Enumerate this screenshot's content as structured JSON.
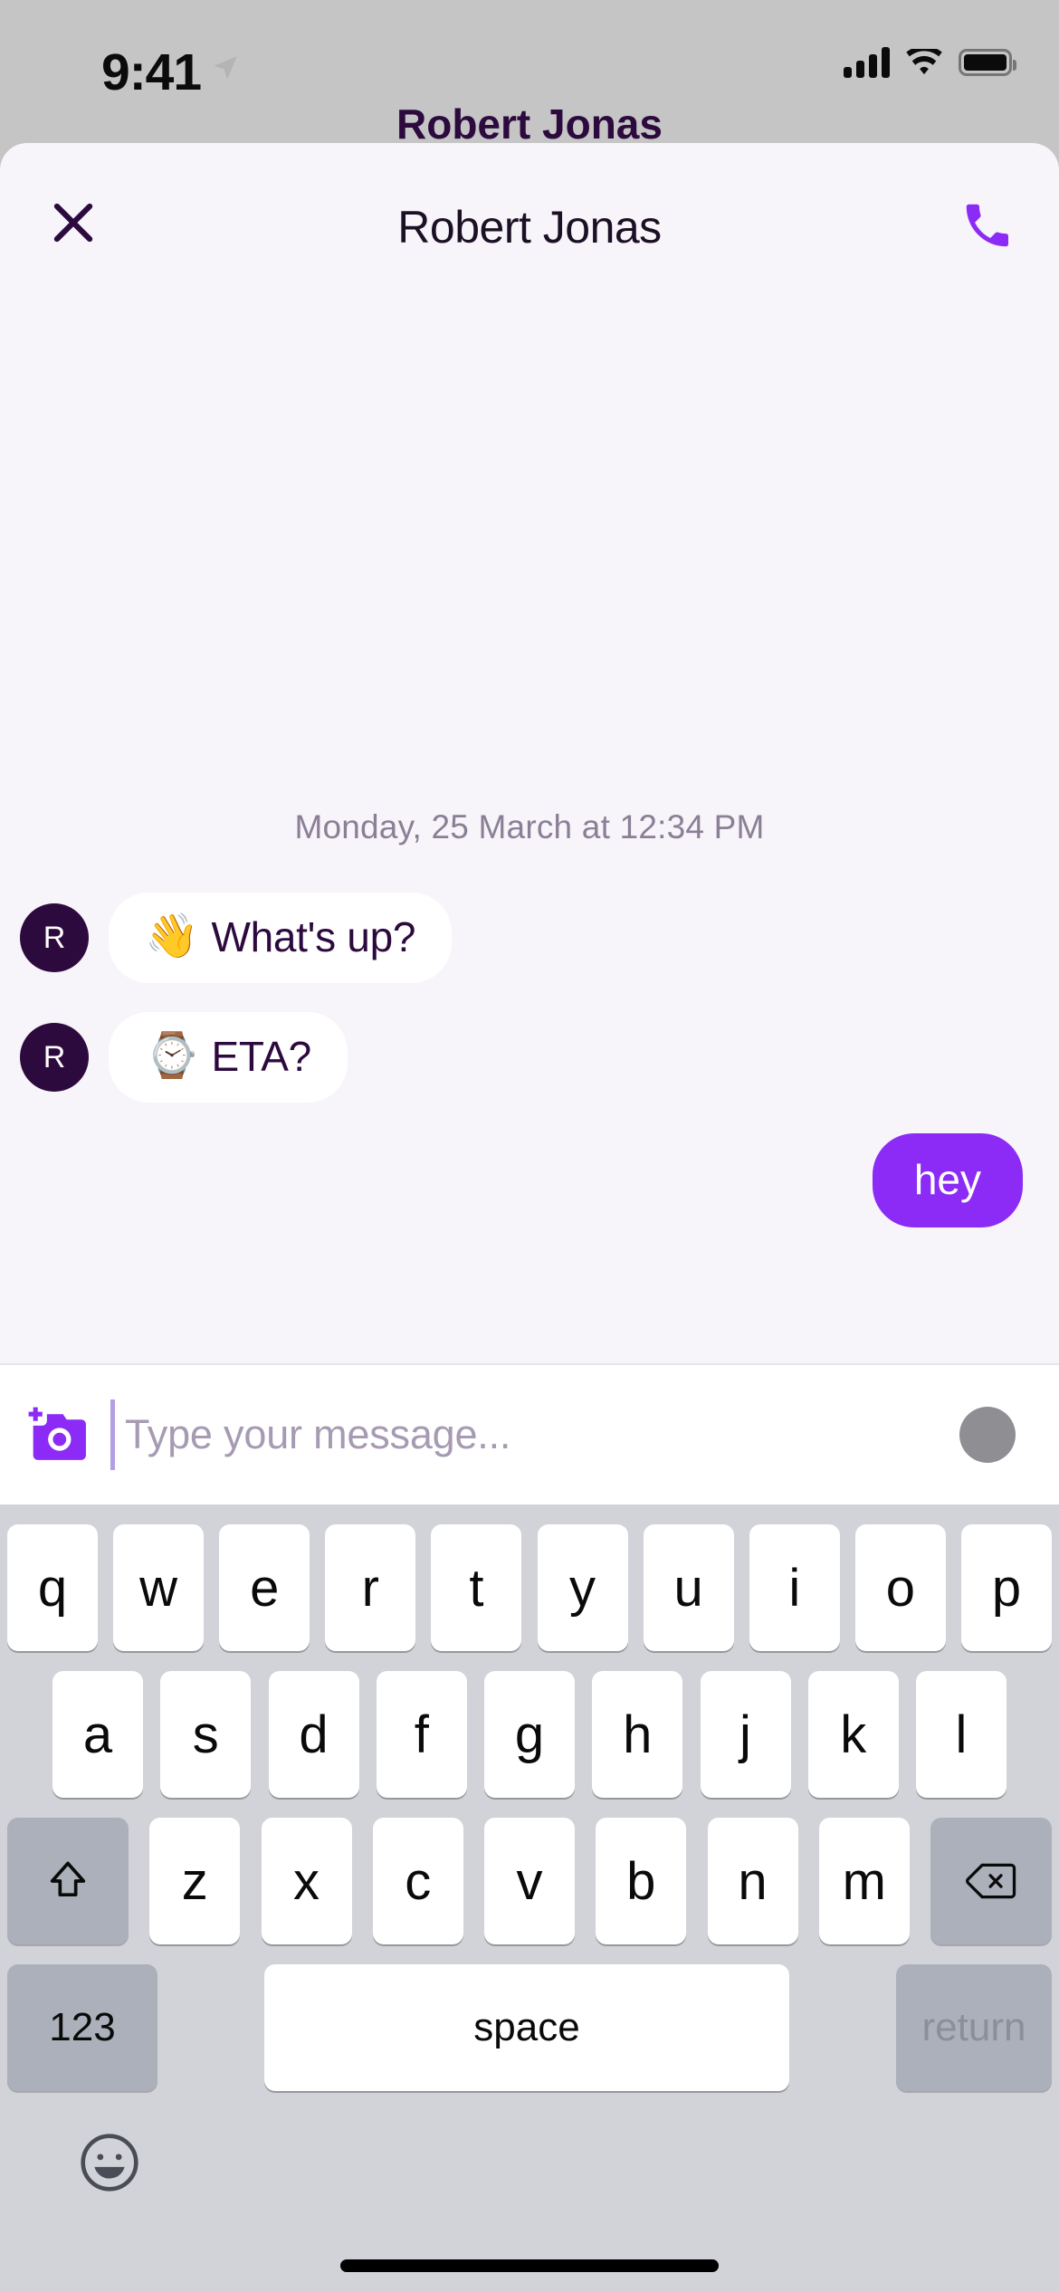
{
  "status_bar": {
    "time": "9:41",
    "location_icon": "location-arrow-icon",
    "signal_icon": "cellular-signal-icon",
    "wifi_icon": "wifi-icon",
    "battery_icon": "battery-full-icon"
  },
  "background": {
    "peek_title": "Robert Jonas"
  },
  "header": {
    "close_icon": "close-x-icon",
    "title": "Robert Jonas",
    "call_icon": "phone-call-icon"
  },
  "conversation": {
    "date_divider": "Monday, 25 March at 12:34 PM",
    "messages": [
      {
        "direction": "in",
        "avatar_initial": "R",
        "emoji": "👋",
        "text": "What's up?"
      },
      {
        "direction": "in",
        "avatar_initial": "R",
        "emoji": "⌚",
        "text": "ETA?"
      },
      {
        "direction": "out",
        "text": "hey"
      }
    ]
  },
  "input_bar": {
    "camera_icon": "add-photo-camera-icon",
    "placeholder": "Type your message...",
    "value": "",
    "send_icon": "send-circle-icon"
  },
  "keyboard": {
    "row1": [
      "q",
      "w",
      "e",
      "r",
      "t",
      "y",
      "u",
      "i",
      "o",
      "p"
    ],
    "row2": [
      "a",
      "s",
      "d",
      "f",
      "g",
      "h",
      "j",
      "k",
      "l"
    ],
    "row3": [
      "z",
      "x",
      "c",
      "v",
      "b",
      "n",
      "m"
    ],
    "shift_icon": "shift-arrow-icon",
    "backspace_icon": "backspace-delete-icon",
    "numbers_label": "123",
    "space_label": "space",
    "return_label": "return",
    "emoji_icon": "emoji-smiley-icon"
  },
  "colors": {
    "accent_purple": "#8b2bf5",
    "dark_purple": "#2d0a3e",
    "sheet_bg": "#f7f4fa",
    "keyboard_bg": "#d1d3d9",
    "send_gray": "#8e8e93"
  }
}
